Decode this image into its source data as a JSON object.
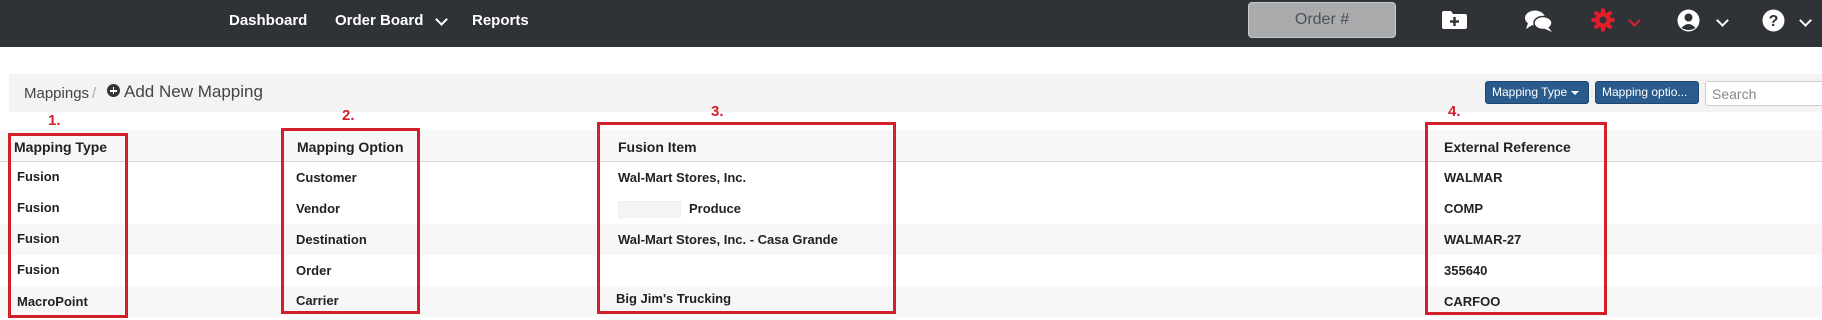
{
  "nav": {
    "dashboard": "Dashboard",
    "order_board": "Order Board",
    "reports": "Reports",
    "order_placeholder": "Order #",
    "icons": [
      "folder-plus-icon",
      "chat-icon",
      "gear-icon",
      "user-icon",
      "help-icon"
    ],
    "gear_color": "#e01d2a"
  },
  "breadcrumb": {
    "mappings": "Mappings",
    "separator": "/",
    "add_new": "Add New Mapping"
  },
  "filters": {
    "mapping_type": "Mapping Type",
    "mapping_option": "Mapping optio...",
    "search_placeholder": "Search"
  },
  "table": {
    "headers": [
      "Mapping Type",
      "Mapping Option",
      "Fusion Item",
      "External Reference"
    ],
    "rows": [
      {
        "type": "Fusion",
        "option": "Customer",
        "item": "Wal-Mart Stores, Inc.",
        "ref": "WALMAR"
      },
      {
        "type": "Fusion",
        "option": "Vendor",
        "item": "Produce",
        "ref": "COMP"
      },
      {
        "type": "Fusion",
        "option": "Destination",
        "item": "Wal-Mart Stores, Inc. - Casa Grande",
        "ref": "WALMAR-27"
      },
      {
        "type": "Fusion",
        "option": "Order",
        "item": "",
        "ref": "355640"
      },
      {
        "type": "MacroPoint",
        "option": "Carrier",
        "item": "Big Jim's Trucking",
        "ref": "CARFOO"
      }
    ]
  },
  "annotations": {
    "labels": [
      "1.",
      "2.",
      "3.",
      "4."
    ],
    "color": "#d21f2b"
  }
}
